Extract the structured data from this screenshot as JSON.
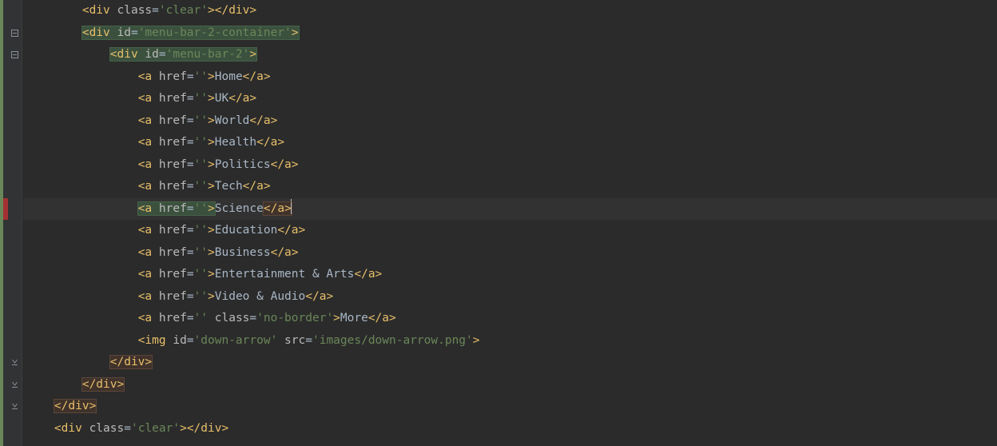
{
  "indent": "    ",
  "lines": [
    {
      "depth": 2,
      "open": "div",
      "attrs": [
        [
          "class",
          "clear"
        ]
      ],
      "close_same_line": true
    },
    {
      "depth": 2,
      "open": "div",
      "attrs": [
        [
          "id",
          "menu-bar-2-container"
        ]
      ],
      "fold": "open",
      "hl_open": true
    },
    {
      "depth": 3,
      "open": "div",
      "attrs": [
        [
          "id",
          "menu-bar-2"
        ]
      ],
      "fold": "open",
      "hl_open": true
    },
    {
      "depth": 4,
      "open": "a",
      "attrs": [
        [
          "href",
          ""
        ]
      ],
      "text": "Home",
      "close_same_line": true
    },
    {
      "depth": 4,
      "open": "a",
      "attrs": [
        [
          "href",
          ""
        ]
      ],
      "text": "UK",
      "close_same_line": true
    },
    {
      "depth": 4,
      "open": "a",
      "attrs": [
        [
          "href",
          ""
        ]
      ],
      "text": "World",
      "close_same_line": true
    },
    {
      "depth": 4,
      "open": "a",
      "attrs": [
        [
          "href",
          ""
        ]
      ],
      "text": "Health",
      "close_same_line": true
    },
    {
      "depth": 4,
      "open": "a",
      "attrs": [
        [
          "href",
          ""
        ]
      ],
      "text": "Politics",
      "close_same_line": true
    },
    {
      "depth": 4,
      "open": "a",
      "attrs": [
        [
          "href",
          ""
        ]
      ],
      "text": "Tech",
      "close_same_line": true
    },
    {
      "depth": 4,
      "open": "a",
      "attrs": [
        [
          "href",
          ""
        ]
      ],
      "text": "Science",
      "close_same_line": true,
      "highlight_line": true,
      "hl_open": true,
      "hl_close": true,
      "cursor_after_close": true,
      "red_gutter": true
    },
    {
      "depth": 4,
      "open": "a",
      "attrs": [
        [
          "href",
          ""
        ]
      ],
      "text": "Education",
      "close_same_line": true
    },
    {
      "depth": 4,
      "open": "a",
      "attrs": [
        [
          "href",
          ""
        ]
      ],
      "text": "Business",
      "close_same_line": true
    },
    {
      "depth": 4,
      "open": "a",
      "attrs": [
        [
          "href",
          ""
        ]
      ],
      "text": "Entertainment & Arts",
      "close_same_line": true
    },
    {
      "depth": 4,
      "open": "a",
      "attrs": [
        [
          "href",
          ""
        ]
      ],
      "text": "Video & Audio",
      "close_same_line": true
    },
    {
      "depth": 4,
      "open": "a",
      "attrs": [
        [
          "href",
          ""
        ],
        [
          "class",
          "no-border"
        ]
      ],
      "text": "More",
      "close_same_line": true
    },
    {
      "depth": 4,
      "open": "img",
      "attrs": [
        [
          "id",
          "down-arrow"
        ],
        [
          "src",
          "images/down-arrow.png"
        ]
      ],
      "self_close": true
    },
    {
      "depth": 3,
      "close": "div",
      "fold": "close",
      "hl_close": true
    },
    {
      "depth": 2,
      "close": "div",
      "fold": "close",
      "hl_close": true
    },
    {
      "depth": 1,
      "close": "div",
      "fold": "close",
      "hl_close": true
    },
    {
      "depth": 1,
      "open": "div",
      "attrs": [
        [
          "class",
          "clear"
        ]
      ],
      "close_same_line": true
    }
  ]
}
